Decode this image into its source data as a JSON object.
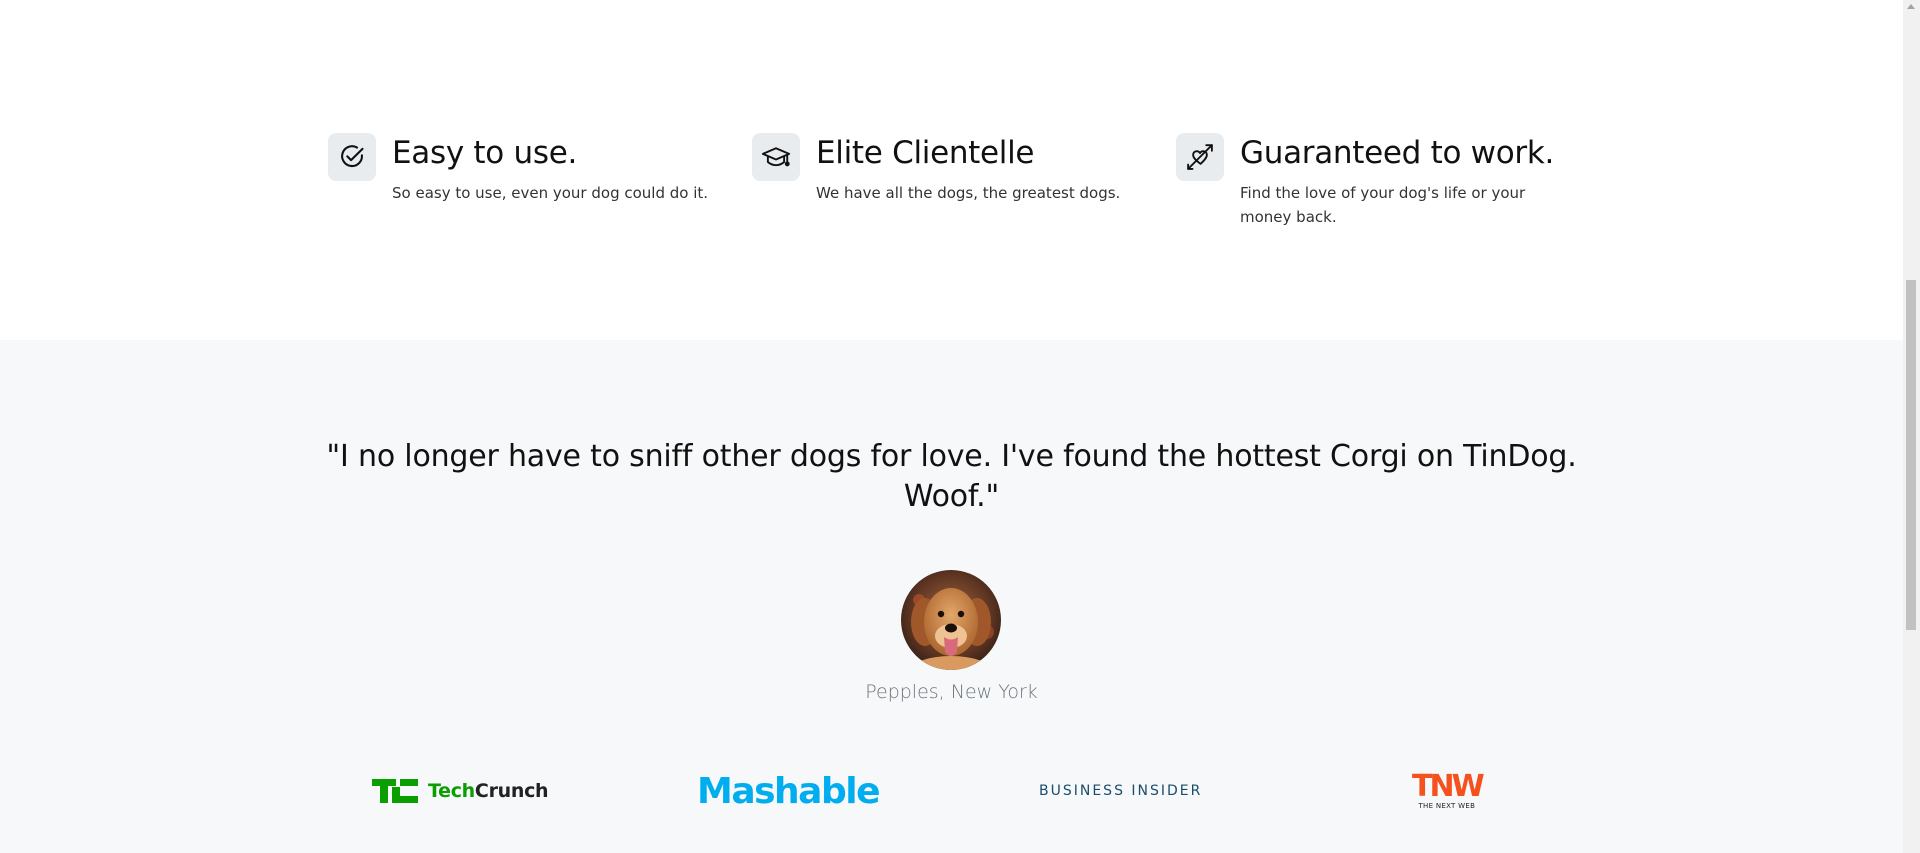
{
  "features": [
    {
      "icon": "check-circle-icon",
      "title": "Easy to use.",
      "text": "So easy to use, even your dog could do it."
    },
    {
      "icon": "graduation-cap-icon",
      "title": "Elite Clientelle",
      "text": "We have all the dogs, the greatest dogs."
    },
    {
      "icon": "heart-arrow-icon",
      "title": "Guaranteed to work.",
      "text": "Find the love of your dog's life or your money back."
    }
  ],
  "testimonial": {
    "quote": "\"I no longer have to sniff other dogs for love. I've found the hottest Corgi on TinDog. Woof.\"",
    "avatar": "dog-avatar",
    "attribution": "Pepples, New York"
  },
  "press": {
    "techcrunch": {
      "mark": "TC",
      "tech": "Tech",
      "crunch": "Crunch"
    },
    "mashable": "Mashable",
    "business_insider": "BUSINESS INSIDER",
    "tnw": {
      "mark": "TNW",
      "sub": "THE NEXT WEB"
    }
  },
  "colors": {
    "section_bg": "#f7f8f9",
    "icon_bg": "#e9ecef",
    "techcrunch_green": "#0a9e01",
    "mashable_blue": "#00aeef",
    "business_insider_navy": "#1b4c6e",
    "tnw_orange": "#f4511e"
  }
}
